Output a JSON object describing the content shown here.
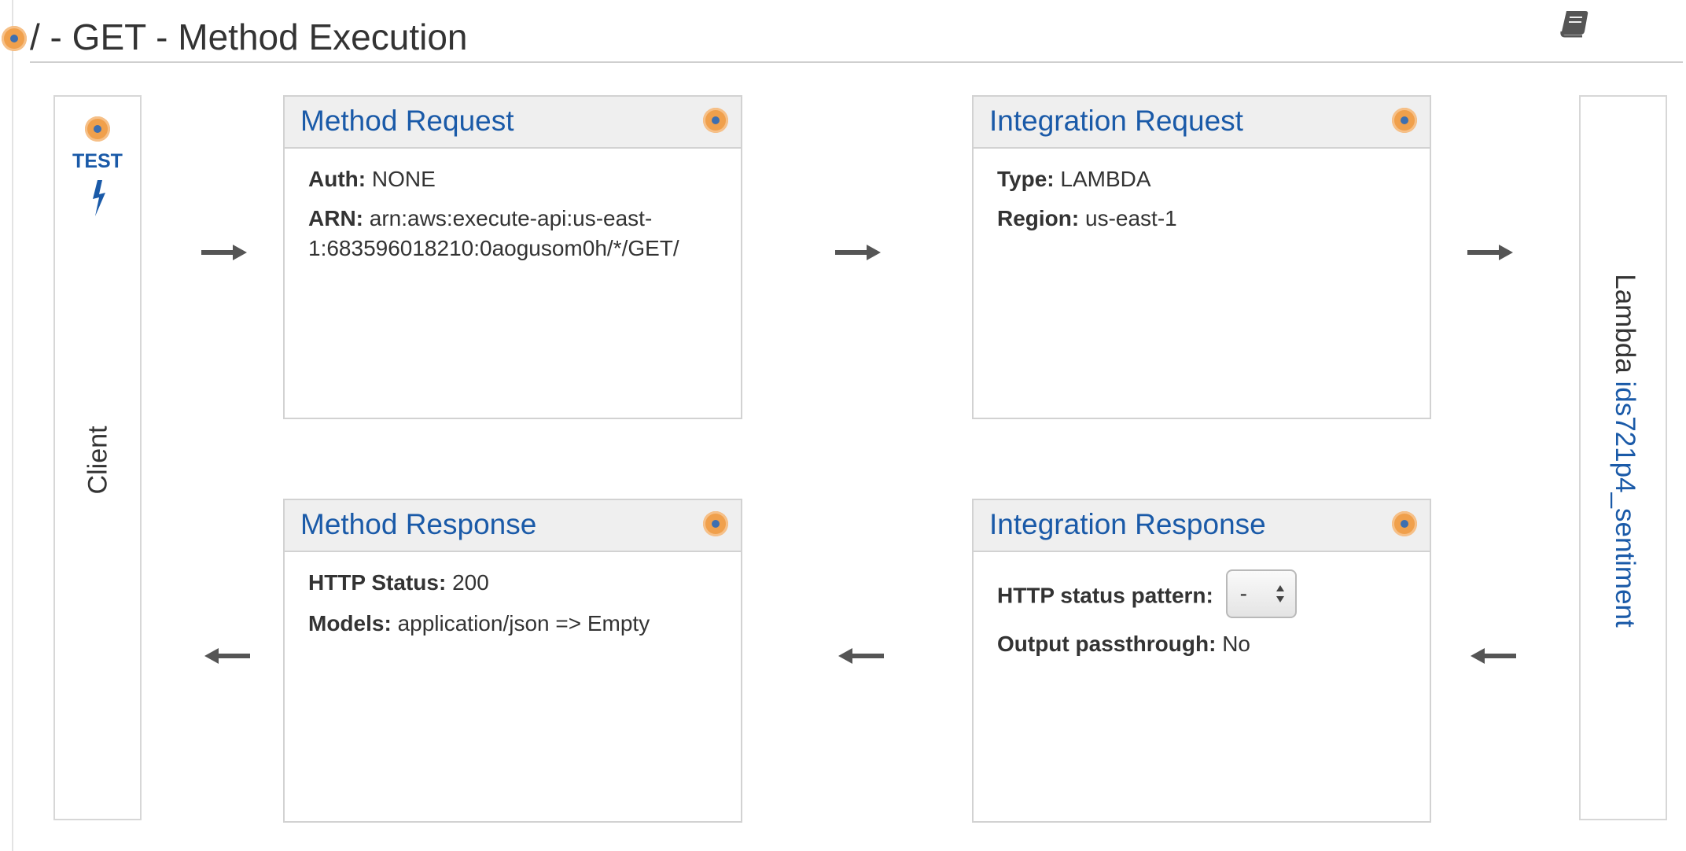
{
  "header": {
    "title": "/ - GET - Method Execution",
    "help_icon": "book-icon"
  },
  "client": {
    "test_label": "TEST",
    "label": "Client"
  },
  "method_request": {
    "title": "Method Request",
    "auth_label": "Auth:",
    "auth_value": "NONE",
    "arn_label": "ARN:",
    "arn_value_line1": "arn:aws:execute-api:us-east-",
    "arn_value_line2": "1:683596018210:0aogusom0h/*/GET/"
  },
  "integration_request": {
    "title": "Integration Request",
    "type_label": "Type:",
    "type_value": "LAMBDA",
    "region_label": "Region:",
    "region_value": "us-east-1"
  },
  "method_response": {
    "title": "Method Response",
    "status_label": "HTTP Status:",
    "status_value": "200",
    "models_label": "Models:",
    "models_value": "application/json => Empty"
  },
  "integration_response": {
    "title": "Integration Response",
    "pattern_label": "HTTP status pattern:",
    "pattern_value": "-",
    "passthrough_label": "Output passthrough:",
    "passthrough_value": "No"
  },
  "lambda": {
    "prefix": "Lambda",
    "function_name": "ids721p4_sentiment"
  },
  "colors": {
    "link": "#1a5aa8",
    "accent_dot": "#f0a04c",
    "header_bg": "#efefef"
  }
}
